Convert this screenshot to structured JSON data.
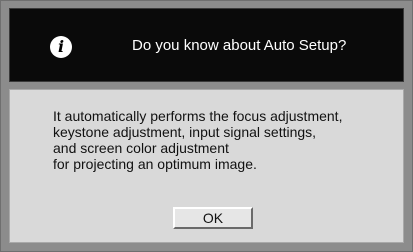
{
  "dialog": {
    "title": "Do you know about Auto Setup?",
    "message_lines": [
      "It automatically performs the focus adjustment,",
      "keystone adjustment, input signal settings,",
      "and screen color adjustment",
      "for projecting an optimum image."
    ],
    "ok_label": "OK",
    "icon": "info-icon"
  },
  "colors": {
    "title_bar": "#0a0a0a",
    "frame": "#8c8c8c",
    "panel": "#d9d9d9",
    "button": "#e6e6e6"
  }
}
